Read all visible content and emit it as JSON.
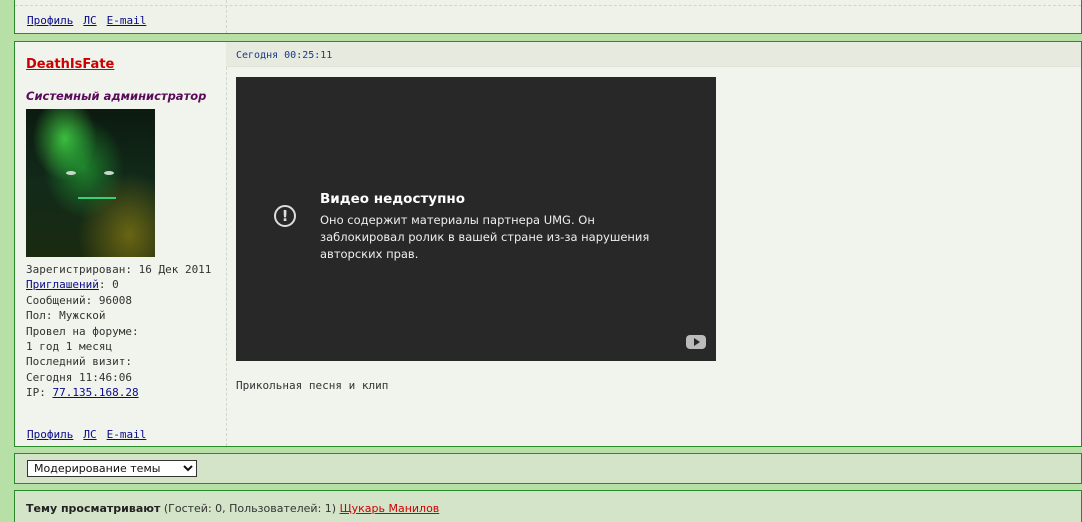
{
  "top_post": {
    "links": [
      "Профиль",
      "ЛС",
      "E-mail"
    ]
  },
  "post": {
    "username": "DeathIsFate",
    "role": "Системный администратор",
    "info": {
      "registered": "Зарегистрирован: 16 Дек 2011",
      "invites_label": "Приглашений",
      "invites_value": ": 0",
      "messages": "Сообщений: 96008",
      "gender": "Пол: Мужской",
      "forum_time_label": "Провел на форуме:",
      "forum_time_value": "1 год 1 месяц",
      "last_visit_label": "Последний визит:",
      "last_visit_value": "Сегодня 11:46:06",
      "ip_label": "IP: ",
      "ip_value": "77.135.168.28"
    },
    "date": "Сегодня 00:25:11",
    "video": {
      "title": "Видео недоступно",
      "message": "Оно содержит материалы партнера UMG. Он заблокировал ролик в вашей стране из-за нарушения авторских прав.",
      "icon": "alert-circle-icon",
      "brand_icon": "youtube-icon"
    },
    "caption": "Прикольная песня и клип",
    "links": [
      "Профиль",
      "ЛС",
      "E-mail"
    ]
  },
  "moderation": {
    "selected": "Модерирование темы"
  },
  "viewers": {
    "label": "Тему просматривают",
    "stats": " (Гостей: 0, Пользователей: 1) ",
    "user": "Щукарь Манилов"
  },
  "colors": {
    "page_bg": "#b7e0a6",
    "border": "#2a8a2a",
    "username": "#cc0000",
    "role": "#5a0b5a",
    "link": "#0a0a8a"
  }
}
